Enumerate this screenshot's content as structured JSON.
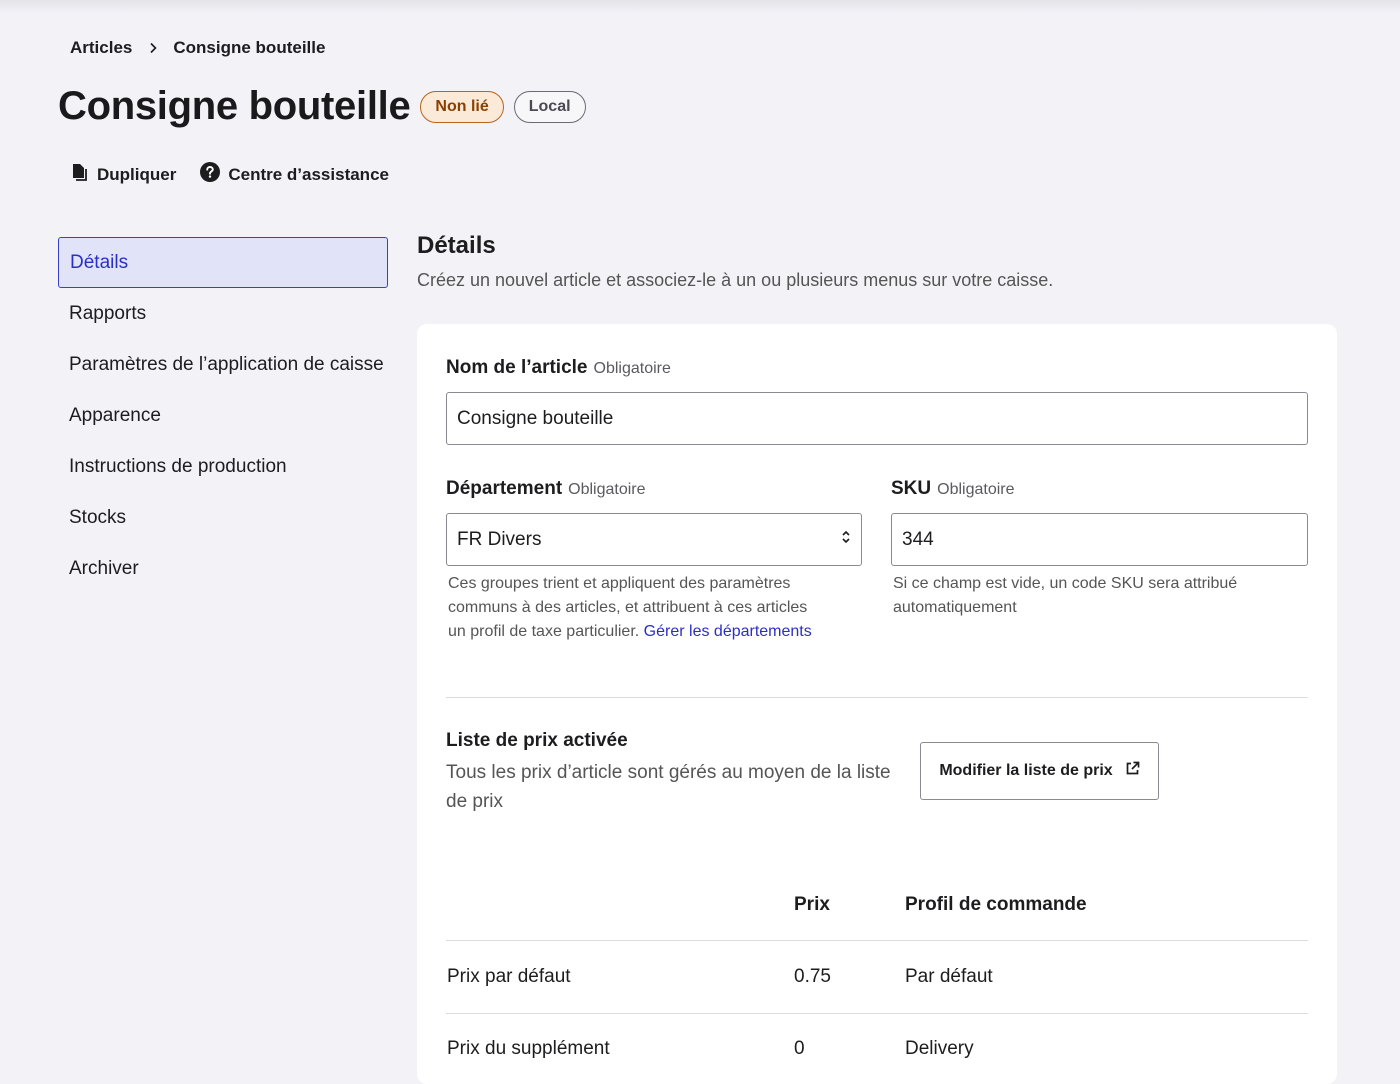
{
  "breadcrumb": {
    "parent": "Articles",
    "current": "Consigne bouteille"
  },
  "header": {
    "title": "Consigne bouteille",
    "badges": [
      "Non lié",
      "Local"
    ]
  },
  "actions": {
    "duplicate": "Dupliquer",
    "help_center": "Centre d’assistance"
  },
  "sidebar": {
    "items": [
      {
        "label": "Détails",
        "active": true
      },
      {
        "label": "Rapports"
      },
      {
        "label": "Paramètres de l’application de caisse"
      },
      {
        "label": "Apparence"
      },
      {
        "label": "Instructions de production"
      },
      {
        "label": "Stocks"
      },
      {
        "label": "Archiver"
      }
    ]
  },
  "main": {
    "title": "Détails",
    "description": "Créez un nouvel article et associez-le à un ou plusieurs menus sur votre caisse.",
    "item_name": {
      "label": "Nom de l’article",
      "required": "Obligatoire",
      "value": "Consigne bouteille"
    },
    "department": {
      "label": "Département",
      "required": "Obligatoire",
      "value": "FR Divers",
      "help": "Ces groupes trient et appliquent des paramètres communs à des articles, et attribuent à ces articles un profil de taxe particulier.",
      "link": "Gérer les départements"
    },
    "sku": {
      "label": "SKU",
      "required": "Obligatoire",
      "value": "344",
      "help": "Si ce champ est vide, un code SKU sera attribué automatiquement"
    },
    "price_list": {
      "title": "Liste de prix activée",
      "description": "Tous les prix d’article sont gérés au moyen de la liste de prix",
      "button": "Modifier la liste de prix"
    },
    "price_table": {
      "headers": [
        "",
        "Prix",
        "Profil de commande"
      ],
      "rows": [
        {
          "name": "Prix par défaut",
          "price": "0.75",
          "profile": "Par défaut"
        },
        {
          "name": "Prix du supplément",
          "price": "0",
          "profile": "Delivery"
        }
      ]
    }
  },
  "colors": {
    "accent": "#2a2fc5",
    "background": "#f2f2f7",
    "warn_badge": "#b5651d"
  }
}
